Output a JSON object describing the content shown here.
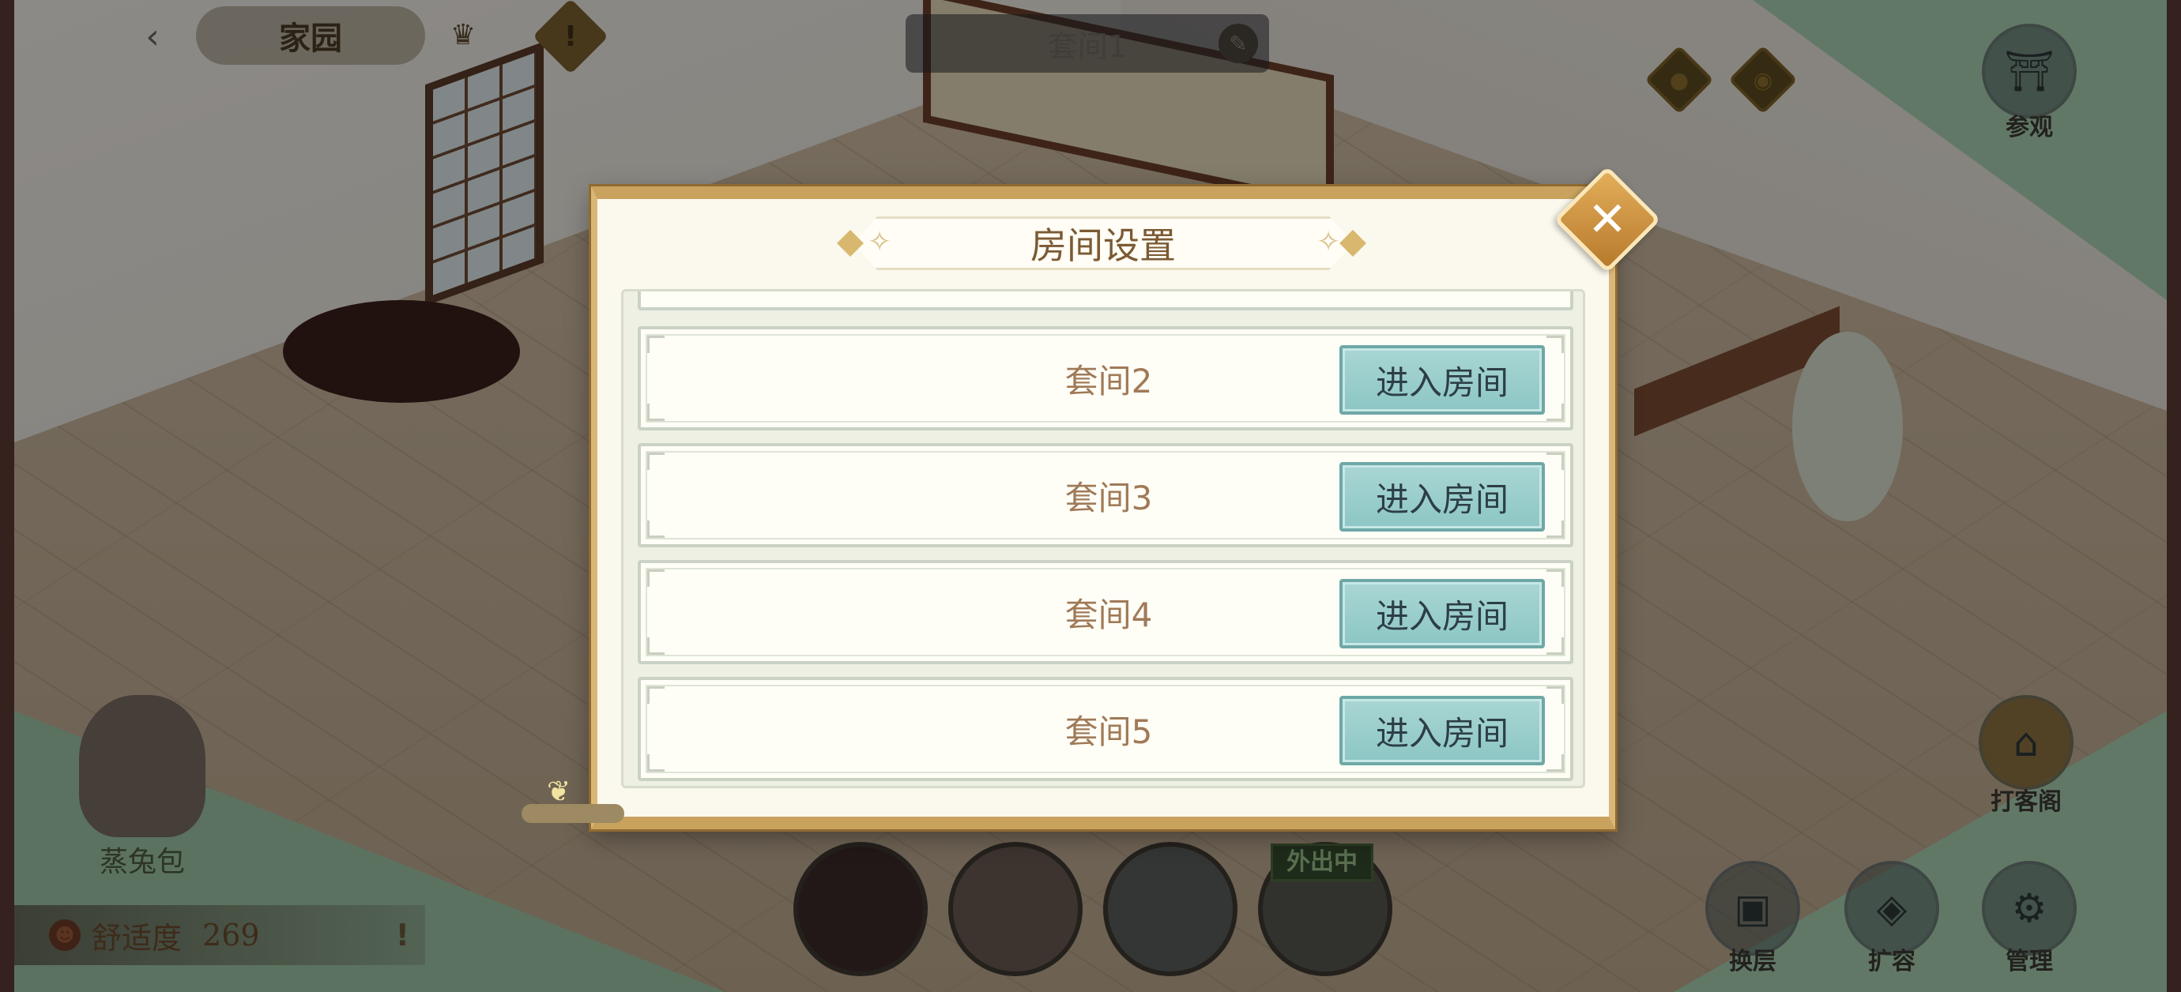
{
  "top_bar": {
    "back_icon": "back-arrow-icon",
    "title": "家园",
    "crown_icon": "crown-icon",
    "warning_icon": "warning-icon"
  },
  "room_title_bar": {
    "label": "套间1",
    "edit_icon": "quill-edit-icon"
  },
  "side_buttons": {
    "visit_label": "参观",
    "floor_label": "换层",
    "expand_label": "扩容",
    "manage_label": "管理",
    "shop_label": "打客阁"
  },
  "resident": {
    "name": "蒸兔包",
    "comfort_label": "舒适度",
    "comfort_value": "269",
    "comfort_warning": "!"
  },
  "portraits": {
    "outing_badge": "外出中"
  },
  "modal": {
    "title": "房间设置",
    "close_glyph": "✕",
    "rooms": [
      {
        "name": "套间2",
        "button": "进入房间"
      },
      {
        "name": "套间3",
        "button": "进入房间"
      },
      {
        "name": "套间4",
        "button": "进入房间"
      },
      {
        "name": "套间5",
        "button": "进入房间"
      }
    ]
  },
  "colors": {
    "modal_border": "#c9a25e",
    "button_teal": "#8cc6c4",
    "title_text": "#7b5a34",
    "room_text": "#a07a58"
  }
}
